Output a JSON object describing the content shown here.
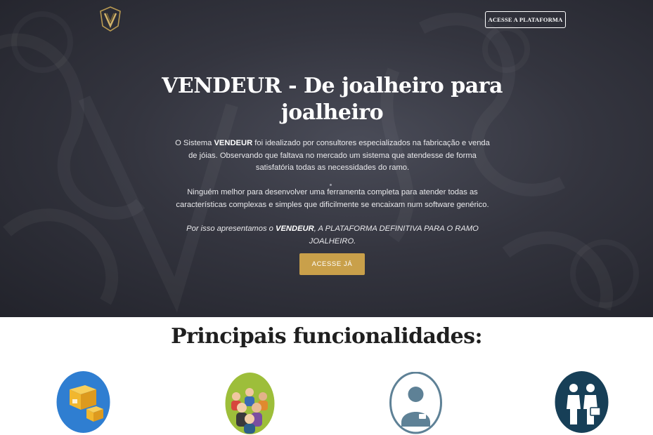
{
  "header": {
    "logo_label": "VENDEUR logo",
    "platform_button_label": "ACESSE A PLATAFORMA"
  },
  "hero": {
    "title": "VENDEUR - De joalheiro para joalheiro",
    "paragraph1": {
      "before": "O Sistema ",
      "brand": "VENDEUR",
      "after": " foi idealizado por consultores especializados na fabricação e venda de jóias. Observando que faltava no mercado um sistema que atendesse de forma satisfatória todas as necessidades do ramo."
    },
    "paragraph2": "Ninguém melhor para desenvolver uma ferramenta completa para atender todas as características complexas e simples que dificilmente se encaixam num software genérico.",
    "paragraph3": {
      "before": "Por isso apresentamos o ",
      "brand": "VENDEUR",
      "after": ", A PLATAFORMA DEFINITIVA PARA O RAMO JOALHEIRO."
    },
    "cta_label": "ACESSE JÁ"
  },
  "features": {
    "title": "Principais funcionalidades:",
    "items": [
      {
        "icon": "boxes-icon",
        "circle_color": "#2f7ed1"
      },
      {
        "icon": "people-group-icon",
        "circle_color": "#9dbe3a"
      },
      {
        "icon": "employee-badge-icon",
        "circle_color": "#5e8196"
      },
      {
        "icon": "handshake-icon",
        "circle_color": "#173f57"
      }
    ]
  },
  "colors": {
    "hero_bg": "#2d2e37",
    "gold_accent": "#c9a04a"
  }
}
